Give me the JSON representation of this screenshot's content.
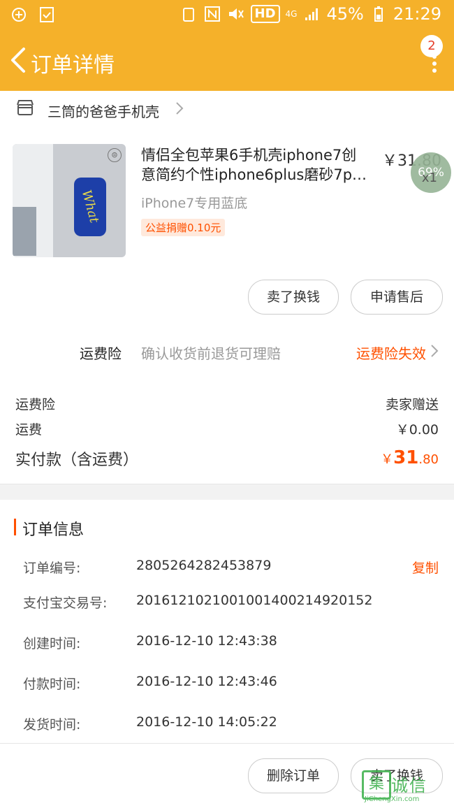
{
  "status_bar": {
    "battery": "45%",
    "time": "21:29",
    "network": "4G",
    "hd": "HD"
  },
  "header": {
    "title": "订单详情",
    "badge_count": "2",
    "bg_color": "#f5b12a"
  },
  "shop": {
    "name": "三筒的爸爸手机壳"
  },
  "product": {
    "title_line1": "情侣全包苹果6手机壳iphone7创",
    "title_line2": "意简约个性iphone6plus磨砂7p…",
    "sku": "iPhone7专用蓝底",
    "tag": "公益捐赠0.10元",
    "price": "￥31.80",
    "quantity": "x1",
    "overlay_percent": "69%",
    "case_text": "What"
  },
  "actions": {
    "sell_label": "卖了换钱",
    "after_sale_label": "申请售后"
  },
  "insurance": {
    "label": "运费险",
    "desc": "确认收货前退货可理赔",
    "status": "运费险失效"
  },
  "fees": {
    "insurance_label": "运费险",
    "insurance_value": "卖家赠送",
    "shipping_label": "运费",
    "shipping_value": "￥0.00",
    "total_label": "实付款（含运费）",
    "total_currency": "￥",
    "total_int": "31",
    "total_dec": ".80"
  },
  "order_info": {
    "title": "订单信息",
    "copy_label": "复制",
    "rows": [
      {
        "key": "订单编号:",
        "value": "2805264282453879"
      },
      {
        "key": "支付宝交易号:",
        "value": "2016121021001001400214920152"
      },
      {
        "key": "创建时间:",
        "value": "2016-12-10 12:43:38"
      },
      {
        "key": "付款时间:",
        "value": "2016-12-10 12:43:46"
      },
      {
        "key": "发货时间:",
        "value": "2016-12-10 14:05:22"
      }
    ]
  },
  "bottom": {
    "delete_label": "删除订单",
    "sell_label": "卖了换钱"
  },
  "watermark": {
    "mark": "集",
    "cn": "诚信",
    "en": "JiChengXin.com"
  },
  "accent_color": "#ff5000"
}
